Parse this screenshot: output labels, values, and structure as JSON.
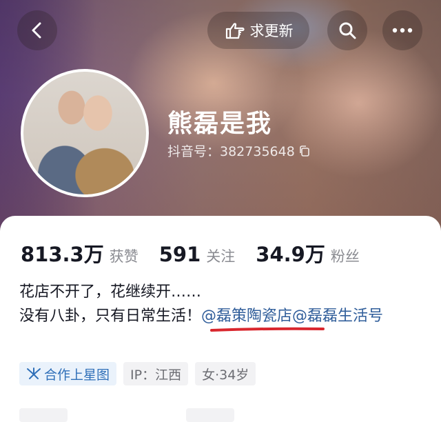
{
  "header": {
    "update_label": "求更新",
    "icons": [
      "back-icon",
      "hand-point-icon",
      "search-icon",
      "more-icon"
    ]
  },
  "profile": {
    "name": "熊磊是我",
    "douyin_id": "抖音号：382735648",
    "copy_icon": "copy-icon"
  },
  "stats": [
    {
      "value": "813.3万",
      "label": "获赞"
    },
    {
      "value": "591",
      "label": "关注"
    },
    {
      "value": "34.9万",
      "label": "粉丝"
    }
  ],
  "bio": {
    "line1": "花店不开了，花继续开……",
    "line2_prefix": "没有八卦，只有日常生活！",
    "mention1": "@磊策陶瓷店",
    "mention2": "@磊磊生活号"
  },
  "tags": [
    {
      "label": "合作上星图"
    },
    {
      "label": "IP：江西"
    },
    {
      "label": "女·34岁"
    }
  ],
  "colors": {
    "mention": "#2f5d9a",
    "annotation_underline": "#d9272e",
    "tag_star_text": "#2f6fb8"
  }
}
